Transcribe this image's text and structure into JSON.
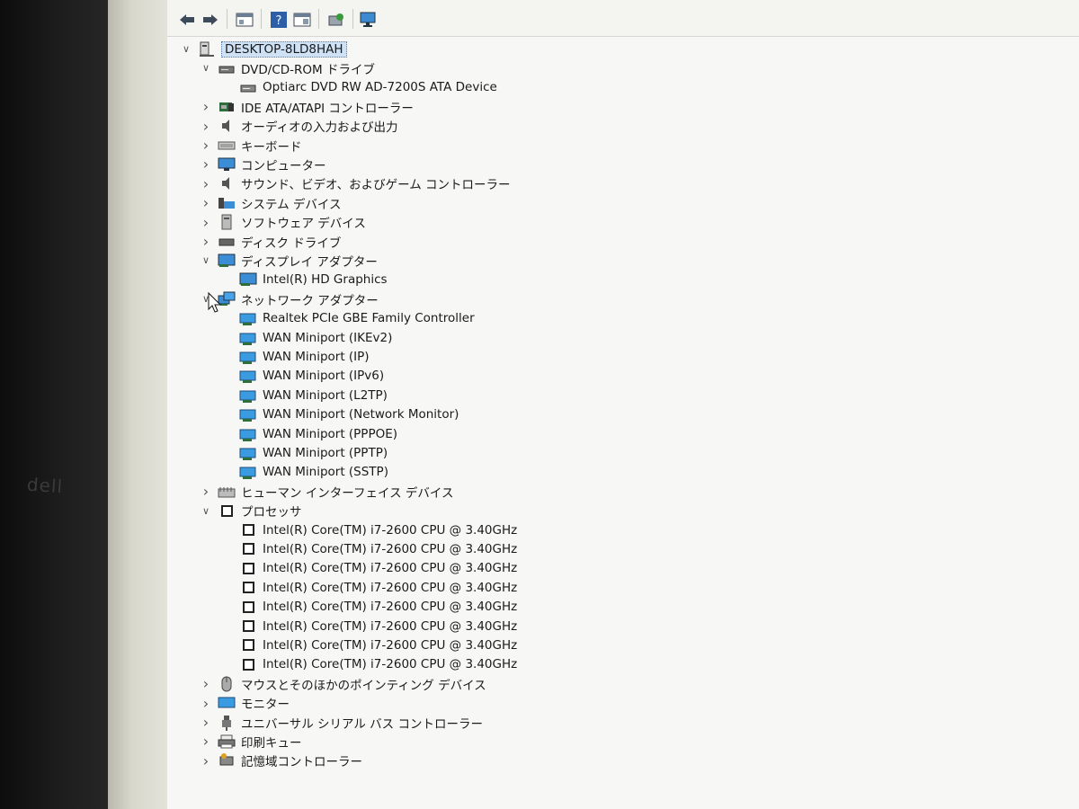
{
  "bezel": {
    "brand": "dell"
  },
  "tree": {
    "root": "DESKTOP-8LD8HAH",
    "categories": [
      {
        "label": "DVD/CD-ROM ドライブ",
        "expanded": true,
        "icon": "dvd-drive-icon",
        "children": [
          "Optiarc DVD RW AD-7200S ATA Device"
        ]
      },
      {
        "label": "IDE ATA/ATAPI コントローラー",
        "expanded": false,
        "icon": "ide-controller-icon"
      },
      {
        "label": "オーディオの入力および出力",
        "expanded": false,
        "icon": "speaker-icon"
      },
      {
        "label": "キーボード",
        "expanded": false,
        "icon": "keyboard-icon"
      },
      {
        "label": "コンピューター",
        "expanded": false,
        "icon": "computer-icon"
      },
      {
        "label": "サウンド、ビデオ、およびゲーム コントローラー",
        "expanded": false,
        "icon": "sound-icon"
      },
      {
        "label": "システム デバイス",
        "expanded": false,
        "icon": "system-device-icon"
      },
      {
        "label": "ソフトウェア デバイス",
        "expanded": false,
        "icon": "software-device-icon"
      },
      {
        "label": "ディスク ドライブ",
        "expanded": false,
        "icon": "disk-drive-icon"
      },
      {
        "label": "ディスプレイ アダプター",
        "expanded": true,
        "icon": "display-adapter-icon",
        "children": [
          "Intel(R) HD Graphics"
        ]
      },
      {
        "label": "ネットワーク アダプター",
        "expanded": true,
        "icon": "network-adapter-icon",
        "children": [
          "Realtek PCIe GBE Family Controller",
          "WAN Miniport (IKEv2)",
          "WAN Miniport (IP)",
          "WAN Miniport (IPv6)",
          "WAN Miniport (L2TP)",
          "WAN Miniport (Network Monitor)",
          "WAN Miniport (PPPOE)",
          "WAN Miniport (PPTP)",
          "WAN Miniport (SSTP)"
        ]
      },
      {
        "label": "ヒューマン インターフェイス デバイス",
        "expanded": false,
        "icon": "hid-icon"
      },
      {
        "label": "プロセッサ",
        "expanded": true,
        "icon": "processor-icon",
        "children": [
          "Intel(R) Core(TM) i7-2600 CPU @ 3.40GHz",
          "Intel(R) Core(TM) i7-2600 CPU @ 3.40GHz",
          "Intel(R) Core(TM) i7-2600 CPU @ 3.40GHz",
          "Intel(R) Core(TM) i7-2600 CPU @ 3.40GHz",
          "Intel(R) Core(TM) i7-2600 CPU @ 3.40GHz",
          "Intel(R) Core(TM) i7-2600 CPU @ 3.40GHz",
          "Intel(R) Core(TM) i7-2600 CPU @ 3.40GHz",
          "Intel(R) Core(TM) i7-2600 CPU @ 3.40GHz"
        ]
      },
      {
        "label": "マウスとそのほかのポインティング デバイス",
        "expanded": false,
        "icon": "mouse-icon"
      },
      {
        "label": "モニター",
        "expanded": false,
        "icon": "monitor-icon"
      },
      {
        "label": "ユニバーサル シリアル バス コントローラー",
        "expanded": false,
        "icon": "usb-icon"
      },
      {
        "label": "印刷キュー",
        "expanded": false,
        "icon": "printer-icon"
      },
      {
        "label": "記憶域コントローラー",
        "expanded": false,
        "icon": "storage-controller-icon"
      }
    ]
  },
  "toolbar": {
    "buttons": [
      "back-icon",
      "forward-icon",
      "properties-icon",
      "help-icon",
      "view-icon",
      "update-driver-icon",
      "scan-hardware-icon"
    ]
  }
}
